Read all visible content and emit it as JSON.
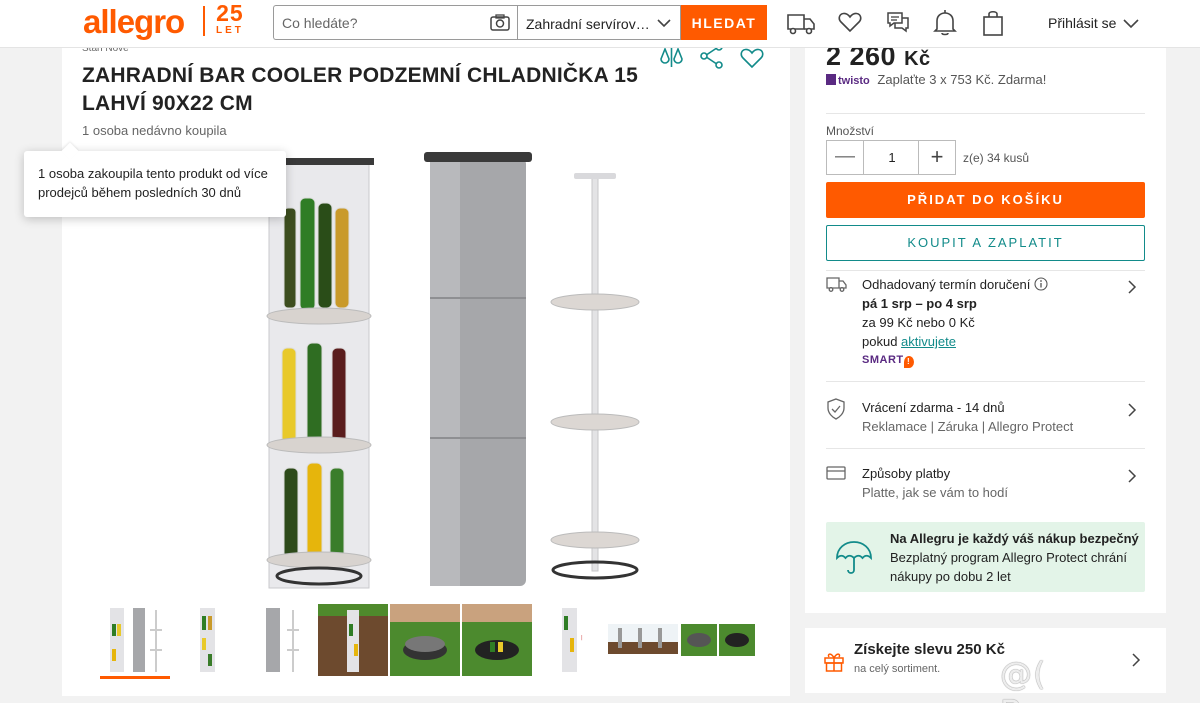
{
  "header": {
    "logo": "allegro",
    "anniversary_number": "25",
    "anniversary_label": "LET",
    "search_placeholder": "Co hledáte?",
    "category": "Zahradní servírovací",
    "search_button": "HLEDAT",
    "login": "Přihlásit se",
    "icons": [
      "camera-icon",
      "chevron-down-icon",
      "delivery-truck-icon",
      "heart-icon",
      "chat-icon",
      "bell-icon",
      "shopping-bag-icon"
    ]
  },
  "product": {
    "breadcrumb_partial": "Stan Nove",
    "title": "ZAHRADNÍ BAR COOLER PODZEMNÍ CHLADNIČKA 15 LAHVÍ 90X22 CM",
    "recent_buyers": "1 osoba nedávno koupila",
    "tooltip": "1 osoba zakoupila tento produkt od více prodejců během posledních 30 dnů",
    "thumbnails_count": 10
  },
  "purchase": {
    "price": "2 260",
    "currency": "Kč",
    "twisto_brand": "twisto",
    "twisto_text": "Zaplaťte 3 x 753 Kč. Zdarma!",
    "quantity_label": "Množství",
    "quantity": "1",
    "stock": "z(e) 34 kusů",
    "add_to_cart": "PŘIDAT DO KOŠÍKU",
    "buy_now": "KOUPIT A ZAPLATIT",
    "delivery_title": "Odhadovaný termín doručení",
    "delivery_dates": "pá 1 srp – po 4 srp",
    "delivery_price": "za 99 Kč nebo 0 Kč",
    "delivery_condition": "pokud",
    "delivery_link": "aktivujete",
    "smart": "SMART",
    "returns_title": "Vrácení zdarma - 14 dnů",
    "returns_sub": "Reklamace | Záruka | Allegro Protect",
    "payment_title": "Způsoby platby",
    "payment_sub": "Platte, jak se vám to hodí",
    "protect_title": "Na Allegru je každý váš nákup bezpečný",
    "protect_line1": "Bezplatný program Allegro Protect chrání",
    "protect_line2": "nákupy po dobu 2 let"
  },
  "promo": {
    "title": "Získejte slevu 250 Kč",
    "sub": "na celý sortiment."
  },
  "watermark": "@( Bazos.cz",
  "colors": {
    "brand": "#ff5a00",
    "teal": "#128b8a",
    "protect_bg": "#e3f4e8"
  }
}
